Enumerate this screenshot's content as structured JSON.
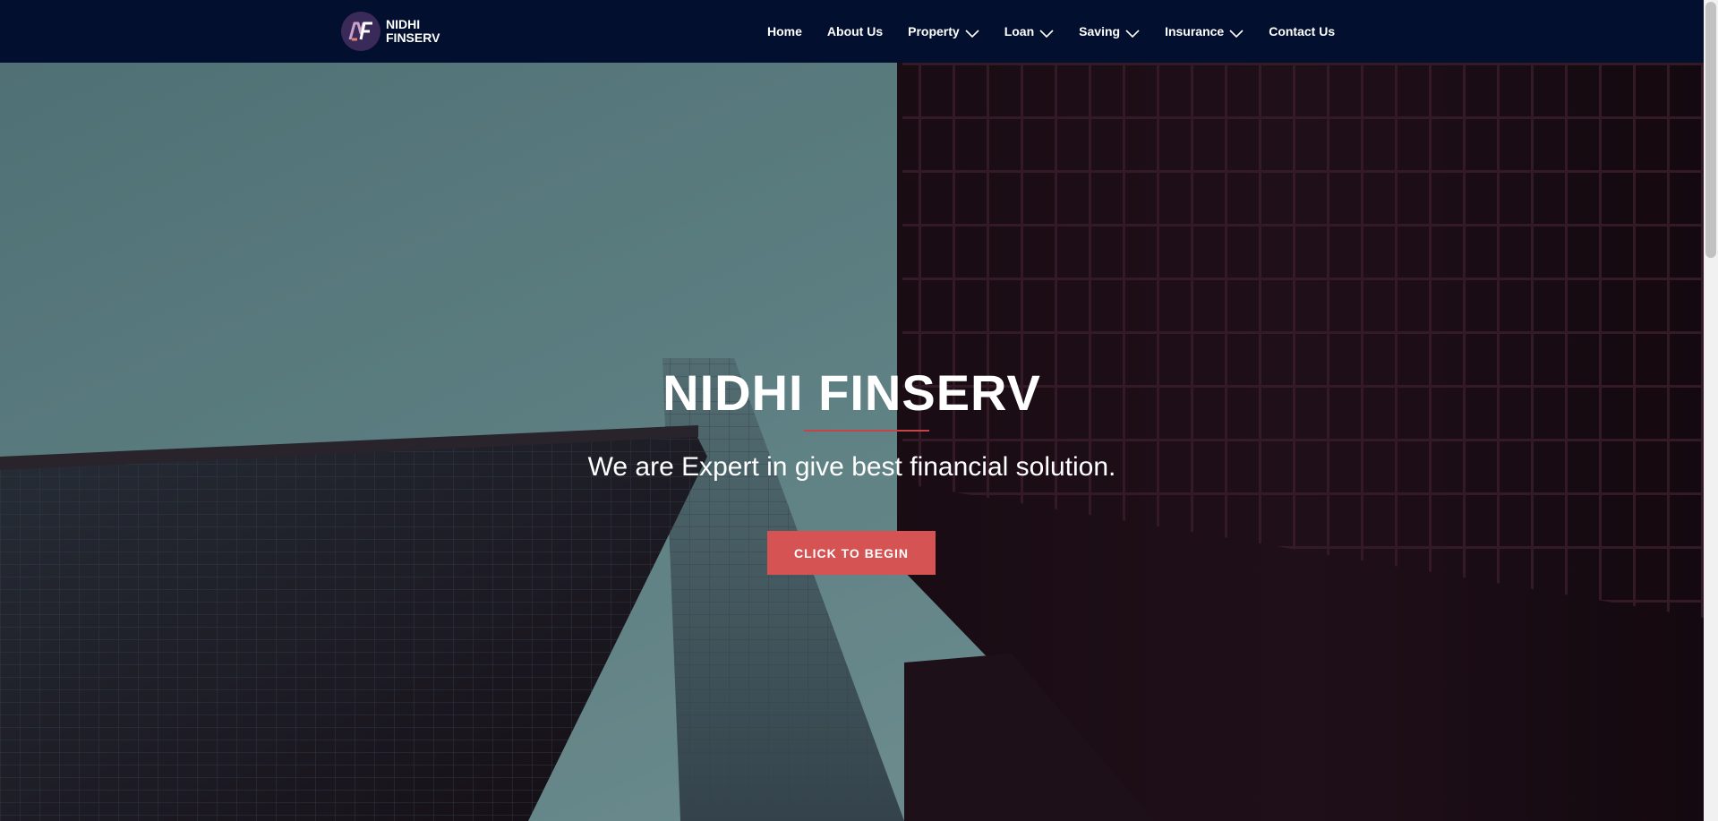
{
  "brand": {
    "logo_letters": "NF",
    "line1": "NIDHI",
    "line2": "FINSERV"
  },
  "nav": {
    "items": [
      {
        "label": "Home",
        "has_dropdown": false
      },
      {
        "label": "About Us",
        "has_dropdown": false
      },
      {
        "label": "Property",
        "has_dropdown": true
      },
      {
        "label": "Loan",
        "has_dropdown": true
      },
      {
        "label": "Saving",
        "has_dropdown": true
      },
      {
        "label": "Insurance",
        "has_dropdown": true
      },
      {
        "label": "Contact Us",
        "has_dropdown": false
      }
    ]
  },
  "hero": {
    "title": "NIDHI FINSERV",
    "subtitle": "We are Expert in give best financial solution.",
    "cta_label": "Click to Begin"
  },
  "colors": {
    "navbar_bg": "#020f2e",
    "accent": "#d55353",
    "rule": "#c7434a",
    "logo_bg": "#3a2a59"
  },
  "icons": {
    "dropdown": "chevron-down-icon",
    "logo": "nf-logo-icon"
  }
}
